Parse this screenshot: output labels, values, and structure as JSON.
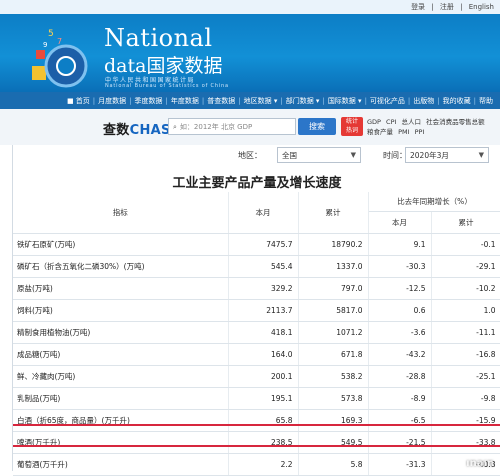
{
  "top_links": [
    "登录",
    "注册",
    "English"
  ],
  "site": {
    "title_en": "National",
    "title_line2_latin": "data",
    "title_line2_cn": "国家数据",
    "sub_cn": "中华人民共和国国家统计局",
    "sub_en": "National Bureau of Statistics of China"
  },
  "nav": [
    "首页",
    "月度数据",
    "季度数据",
    "年度数据",
    "普查数据",
    "地区数据",
    "部门数据",
    "国际数据",
    "可视化产品",
    "出版物",
    "我的收藏",
    "帮助"
  ],
  "search": {
    "logo_prefix": "查数",
    "logo_brand": "CHASHU",
    "placeholder": "如：2012年 北京 GDP",
    "button": "搜索",
    "hot_badge_line1": "统计",
    "hot_badge_line2": "热词",
    "quick_links_row1": [
      "GDP",
      "CPI",
      "总人口",
      "社会消费品零售总额"
    ],
    "quick_links_row2": [
      "粮食产量",
      "PMI",
      "PPI"
    ]
  },
  "filters": {
    "region_label": "地区：",
    "region_value": "全国",
    "time_label": "时间：",
    "time_value": "2020年3月"
  },
  "table": {
    "title": "工业主要产品产量及增长速度",
    "headers": {
      "indicator": "指标",
      "this_month": "本月",
      "cumulative": "累计",
      "yoy_group": "比去年同期增长（%）",
      "yoy_month": "本月",
      "yoy_cumulative": "累计"
    },
    "rows": [
      {
        "name": "铁矿石原矿(万吨)",
        "month": "7475.7",
        "cum": "18790.2",
        "yoy_month": "9.1",
        "yoy_cum": "-0.1"
      },
      {
        "name": "磷矿石（折含五氧化二磷30%）(万吨)",
        "month": "545.4",
        "cum": "1337.0",
        "yoy_month": "-30.3",
        "yoy_cum": "-29.1"
      },
      {
        "name": "原盐(万吨)",
        "month": "329.2",
        "cum": "797.0",
        "yoy_month": "-12.5",
        "yoy_cum": "-10.2"
      },
      {
        "name": "饲料(万吨)",
        "month": "2113.7",
        "cum": "5817.0",
        "yoy_month": "0.6",
        "yoy_cum": "1.0"
      },
      {
        "name": "精制食用植物油(万吨)",
        "month": "418.1",
        "cum": "1071.2",
        "yoy_month": "-3.6",
        "yoy_cum": "-11.1"
      },
      {
        "name": "成品糖(万吨)",
        "month": "164.0",
        "cum": "671.8",
        "yoy_month": "-43.2",
        "yoy_cum": "-16.8"
      },
      {
        "name": "鲜、冷藏肉(万吨)",
        "month": "200.1",
        "cum": "538.2",
        "yoy_month": "-28.8",
        "yoy_cum": "-25.1"
      },
      {
        "name": "乳制品(万吨)",
        "month": "195.1",
        "cum": "573.8",
        "yoy_month": "-8.9",
        "yoy_cum": "-9.8"
      },
      {
        "name": "白酒（折65度，商品量）(万千升)",
        "month": "65.8",
        "cum": "169.3",
        "yoy_month": "-6.5",
        "yoy_cum": "-15.9"
      },
      {
        "name": "啤酒(万千升)",
        "month": "238.5",
        "cum": "549.5",
        "yoy_month": "-21.5",
        "yoy_cum": "-33.8"
      },
      {
        "name": "葡萄酒(万千升)",
        "month": "2.2",
        "cum": "5.8",
        "yoy_month": "-31.3",
        "yoy_cum": "-40.8"
      }
    ]
  },
  "colors": {
    "banner_blue": "#1290d6",
    "nav_blue": "#1a6cb0",
    "highlight_red": "#d7263d"
  }
}
